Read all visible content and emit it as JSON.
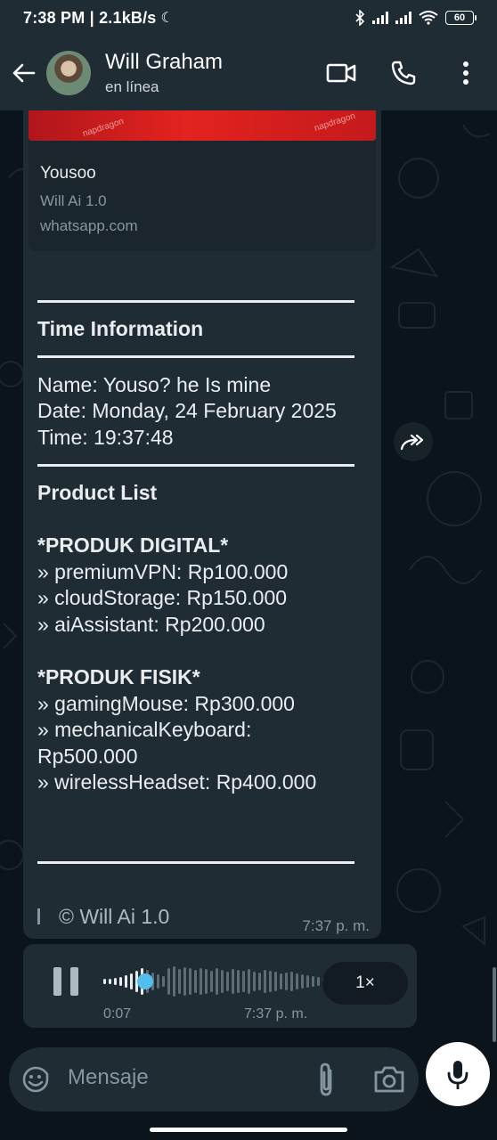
{
  "status_bar": {
    "time": "7:38 PM | 2.1kB/s",
    "battery": "60"
  },
  "header": {
    "contact_name": "Will Graham",
    "contact_status": "en línea"
  },
  "link_preview": {
    "title": "Yousoo",
    "description": "Will Ai 1.0",
    "url": "whatsapp.com"
  },
  "message": {
    "time_section_title": "Time Information",
    "name_line": "Name: Youso? he Is mine",
    "date_line": "Date: Monday, 24 February 2025",
    "time_line": "Time: 19:37:48",
    "product_section_title": "Product List",
    "digital_heading": "*PRODUK DIGITAL*",
    "digital_items": [
      "» premiumVPN: Rp100.000",
      "» cloudStorage: Rp150.000",
      "» aiAssistant: Rp200.000"
    ],
    "physical_heading": "*PRODUK FISIK*",
    "physical_items": [
      "» gamingMouse: Rp300.000",
      "» mechanicalKeyboard:",
      "Rp500.000",
      "» wirelessHeadset: Rp400.000"
    ],
    "footer": "© Will Ai 1.0",
    "timestamp": "7:37 p. m."
  },
  "voice_message": {
    "duration": "0:07",
    "timestamp": "7:37 p. m.",
    "speed": "1×",
    "progress": 0.19
  },
  "input": {
    "placeholder": "Mensaje"
  },
  "colors": {
    "bubble": "#202c33",
    "background": "#0b141a",
    "bar": "#1f2c34",
    "accent": "#53bdeb"
  }
}
